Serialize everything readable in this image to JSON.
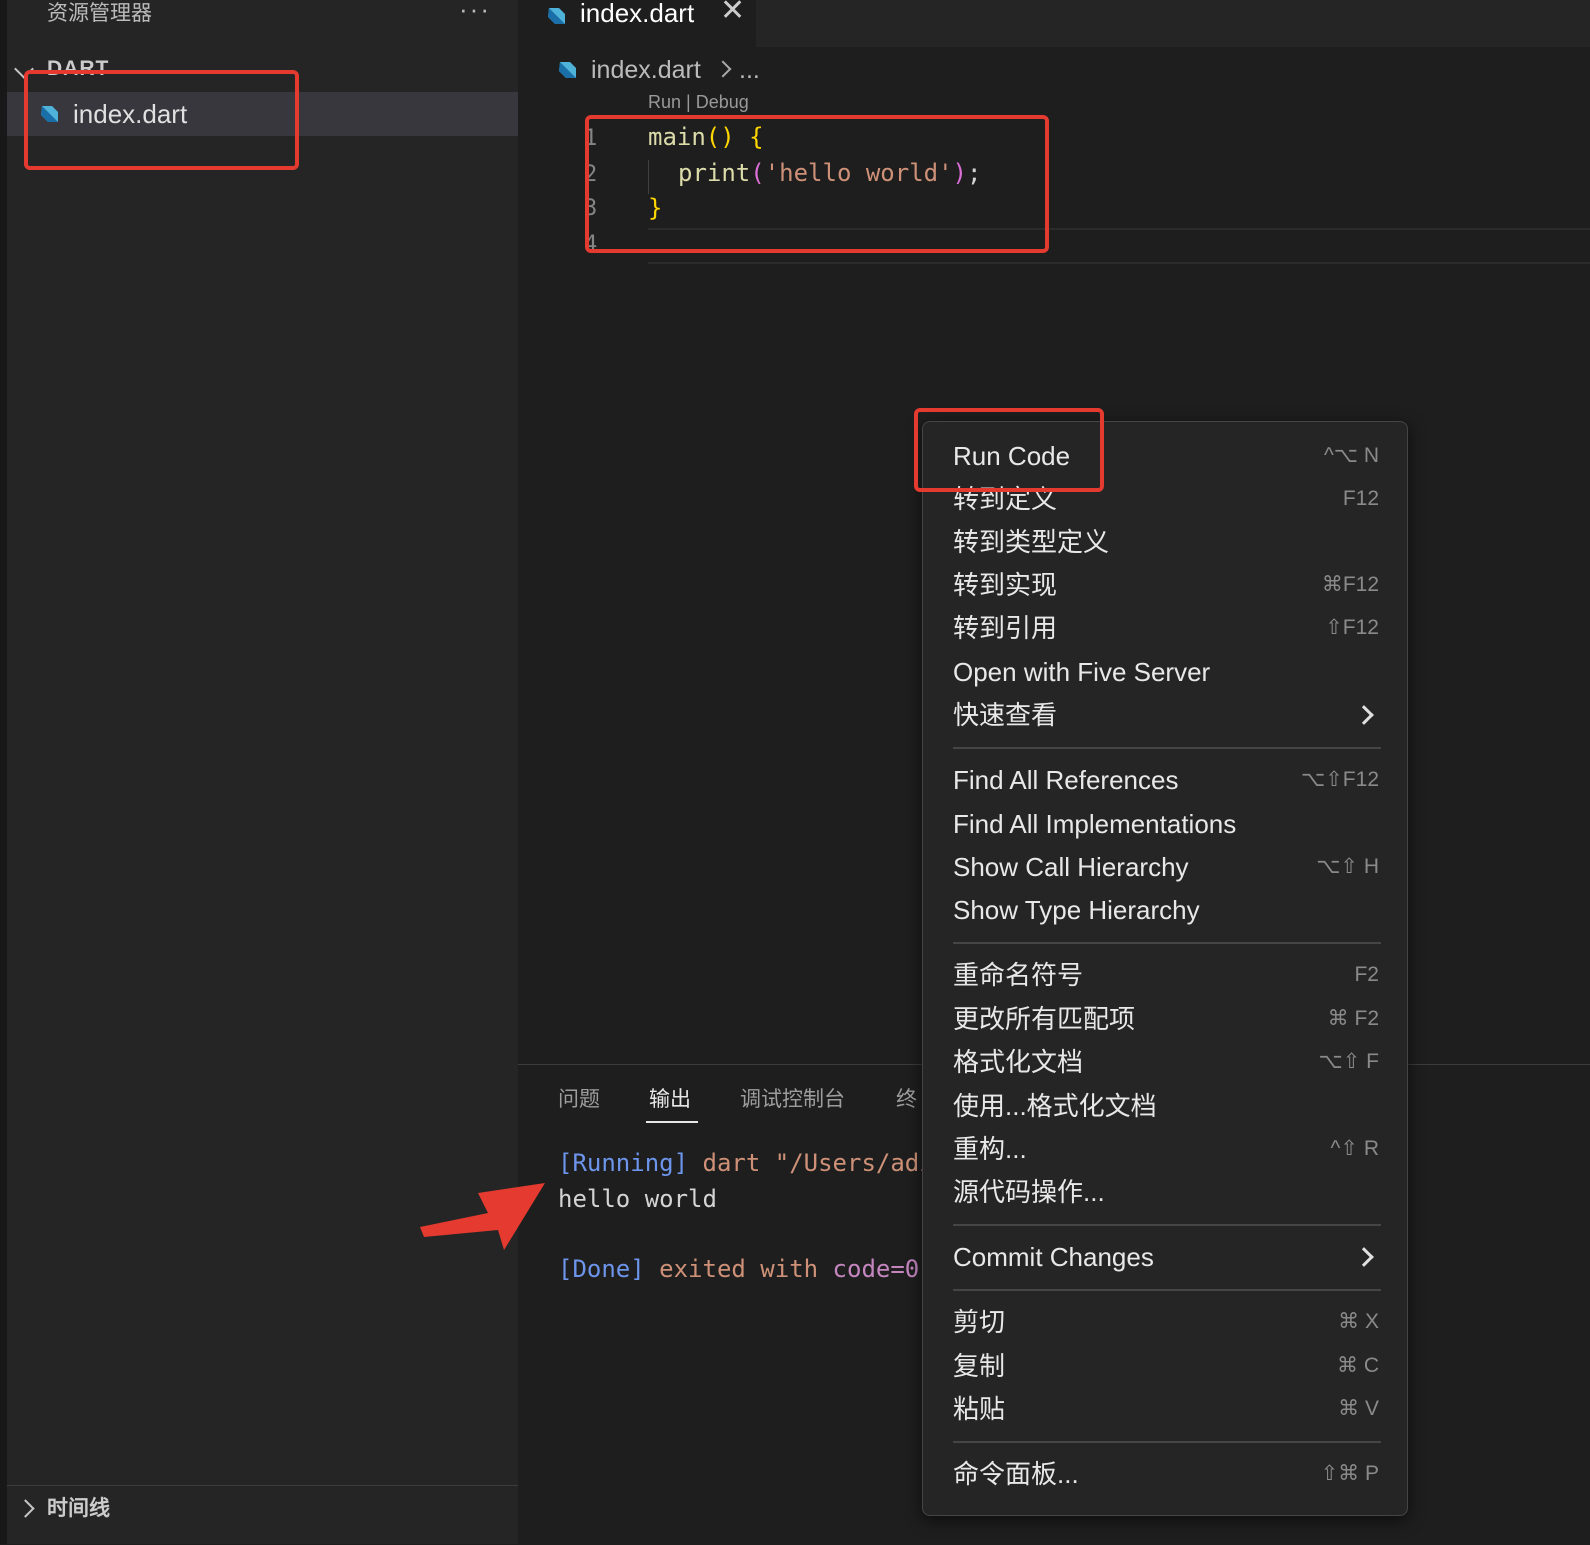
{
  "explorer": {
    "title": "资源管理器",
    "more": "···",
    "folder": "DART",
    "file": "index.dart",
    "timeline": "时间线"
  },
  "editor": {
    "tab_label": "index.dart",
    "tab_close": "✕",
    "breadcrumb_file": "index.dart",
    "breadcrumb_more": "...",
    "codelens": "Run | Debug",
    "line_numbers": [
      "1",
      "2",
      "3",
      "4"
    ],
    "code": {
      "l1_fn": "main",
      "l1_parens": "()",
      "l1_brace": "{",
      "l2_fn": "print",
      "l2_open": "(",
      "l2_str": "'hello world'",
      "l2_close": ")",
      "l2_semi": ";",
      "l3_brace": "}"
    }
  },
  "panel": {
    "tabs": [
      "问题",
      "输出",
      "调试控制台",
      "终"
    ],
    "output": {
      "running_tag": "[Running]",
      "running_cmd": " dart \"/Users/adı",
      "hello": "hello world",
      "done_tag": "[Done]",
      "done_text": " exited with ",
      "done_code": "code=0"
    }
  },
  "context_menu": {
    "items": [
      {
        "label": "Run Code",
        "key": "^⌥ N"
      },
      {
        "label": "转到定义",
        "key": "F12"
      },
      {
        "label": "转到类型定义",
        "key": ""
      },
      {
        "label": "转到实现",
        "key": "⌘F12"
      },
      {
        "label": "转到引用",
        "key": "⇧F12"
      },
      {
        "label": "Open with Five Server",
        "key": ""
      },
      {
        "label": "快速查看",
        "key": ""
      },
      {
        "label": "Find All References",
        "key": "⌥⇧F12"
      },
      {
        "label": "Find All Implementations",
        "key": ""
      },
      {
        "label": "Show Call Hierarchy",
        "key": "⌥⇧ H"
      },
      {
        "label": "Show Type Hierarchy",
        "key": ""
      },
      {
        "label": "重命名符号",
        "key": "F2"
      },
      {
        "label": "更改所有匹配项",
        "key": "⌘ F2"
      },
      {
        "label": "格式化文档",
        "key": "⌥⇧ F"
      },
      {
        "label": "使用...格式化文档",
        "key": ""
      },
      {
        "label": "重构...",
        "key": "^⇧ R"
      },
      {
        "label": "源代码操作...",
        "key": ""
      },
      {
        "label": "Commit Changes",
        "key": ""
      },
      {
        "label": "剪切",
        "key": "⌘ X"
      },
      {
        "label": "复制",
        "key": "⌘ C"
      },
      {
        "label": "粘贴",
        "key": "⌘ V"
      },
      {
        "label": "命令面板...",
        "key": "⇧⌘ P"
      }
    ]
  },
  "colors": {
    "annotation": "#e53a2f",
    "accent": "#6c95eb"
  }
}
